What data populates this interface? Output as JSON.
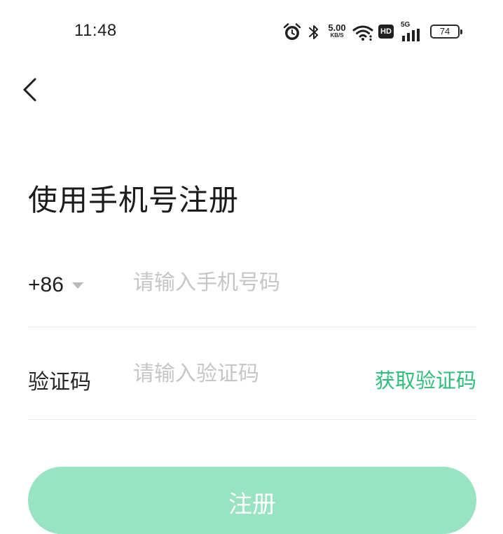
{
  "status_bar": {
    "time": "11:48",
    "net_speed_value": "5.00",
    "net_speed_unit": "KB/S",
    "hd_label": "HD",
    "network_label": "5G",
    "battery_level": "74",
    "icons": [
      "alarm-icon",
      "bluetooth-icon",
      "wifi-icon",
      "hd-icon",
      "signal-5g-icon",
      "battery-icon"
    ]
  },
  "header": {
    "back_icon": "chevron-left-icon"
  },
  "title": "使用手机号注册",
  "phone_row": {
    "country_code": "+86",
    "placeholder": "请输入手机号码",
    "value": ""
  },
  "code_row": {
    "label": "验证码",
    "placeholder": "请输入验证码",
    "value": "",
    "get_code_label": "获取验证码"
  },
  "register_button": {
    "label": "注册"
  },
  "colors": {
    "accent": "#2fbf7a",
    "button_disabled": "#98e3c2",
    "placeholder": "#c6c6c6",
    "divider": "#e9e9e9"
  }
}
